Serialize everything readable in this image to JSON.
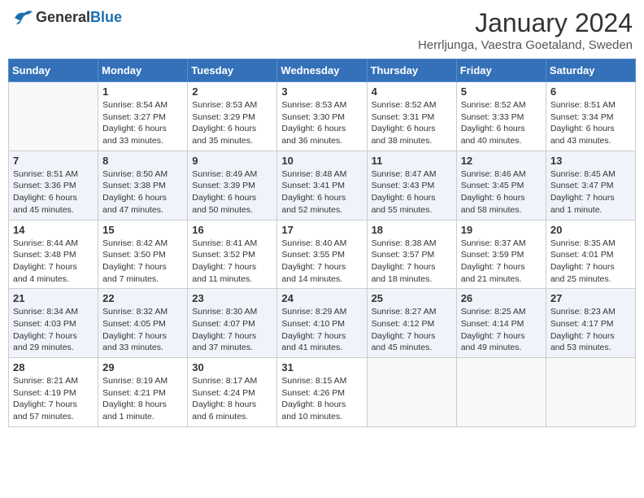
{
  "header": {
    "logo_general": "General",
    "logo_blue": "Blue",
    "title": "January 2024",
    "subtitle": "Herrljunga, Vaestra Goetaland, Sweden"
  },
  "columns": [
    "Sunday",
    "Monday",
    "Tuesday",
    "Wednesday",
    "Thursday",
    "Friday",
    "Saturday"
  ],
  "weeks": [
    [
      {
        "day": "",
        "info": ""
      },
      {
        "day": "1",
        "info": "Sunrise: 8:54 AM\nSunset: 3:27 PM\nDaylight: 6 hours\nand 33 minutes."
      },
      {
        "day": "2",
        "info": "Sunrise: 8:53 AM\nSunset: 3:29 PM\nDaylight: 6 hours\nand 35 minutes."
      },
      {
        "day": "3",
        "info": "Sunrise: 8:53 AM\nSunset: 3:30 PM\nDaylight: 6 hours\nand 36 minutes."
      },
      {
        "day": "4",
        "info": "Sunrise: 8:52 AM\nSunset: 3:31 PM\nDaylight: 6 hours\nand 38 minutes."
      },
      {
        "day": "5",
        "info": "Sunrise: 8:52 AM\nSunset: 3:33 PM\nDaylight: 6 hours\nand 40 minutes."
      },
      {
        "day": "6",
        "info": "Sunrise: 8:51 AM\nSunset: 3:34 PM\nDaylight: 6 hours\nand 43 minutes."
      }
    ],
    [
      {
        "day": "7",
        "info": "Sunrise: 8:51 AM\nSunset: 3:36 PM\nDaylight: 6 hours\nand 45 minutes."
      },
      {
        "day": "8",
        "info": "Sunrise: 8:50 AM\nSunset: 3:38 PM\nDaylight: 6 hours\nand 47 minutes."
      },
      {
        "day": "9",
        "info": "Sunrise: 8:49 AM\nSunset: 3:39 PM\nDaylight: 6 hours\nand 50 minutes."
      },
      {
        "day": "10",
        "info": "Sunrise: 8:48 AM\nSunset: 3:41 PM\nDaylight: 6 hours\nand 52 minutes."
      },
      {
        "day": "11",
        "info": "Sunrise: 8:47 AM\nSunset: 3:43 PM\nDaylight: 6 hours\nand 55 minutes."
      },
      {
        "day": "12",
        "info": "Sunrise: 8:46 AM\nSunset: 3:45 PM\nDaylight: 6 hours\nand 58 minutes."
      },
      {
        "day": "13",
        "info": "Sunrise: 8:45 AM\nSunset: 3:47 PM\nDaylight: 7 hours\nand 1 minute."
      }
    ],
    [
      {
        "day": "14",
        "info": "Sunrise: 8:44 AM\nSunset: 3:48 PM\nDaylight: 7 hours\nand 4 minutes."
      },
      {
        "day": "15",
        "info": "Sunrise: 8:42 AM\nSunset: 3:50 PM\nDaylight: 7 hours\nand 7 minutes."
      },
      {
        "day": "16",
        "info": "Sunrise: 8:41 AM\nSunset: 3:52 PM\nDaylight: 7 hours\nand 11 minutes."
      },
      {
        "day": "17",
        "info": "Sunrise: 8:40 AM\nSunset: 3:55 PM\nDaylight: 7 hours\nand 14 minutes."
      },
      {
        "day": "18",
        "info": "Sunrise: 8:38 AM\nSunset: 3:57 PM\nDaylight: 7 hours\nand 18 minutes."
      },
      {
        "day": "19",
        "info": "Sunrise: 8:37 AM\nSunset: 3:59 PM\nDaylight: 7 hours\nand 21 minutes."
      },
      {
        "day": "20",
        "info": "Sunrise: 8:35 AM\nSunset: 4:01 PM\nDaylight: 7 hours\nand 25 minutes."
      }
    ],
    [
      {
        "day": "21",
        "info": "Sunrise: 8:34 AM\nSunset: 4:03 PM\nDaylight: 7 hours\nand 29 minutes."
      },
      {
        "day": "22",
        "info": "Sunrise: 8:32 AM\nSunset: 4:05 PM\nDaylight: 7 hours\nand 33 minutes."
      },
      {
        "day": "23",
        "info": "Sunrise: 8:30 AM\nSunset: 4:07 PM\nDaylight: 7 hours\nand 37 minutes."
      },
      {
        "day": "24",
        "info": "Sunrise: 8:29 AM\nSunset: 4:10 PM\nDaylight: 7 hours\nand 41 minutes."
      },
      {
        "day": "25",
        "info": "Sunrise: 8:27 AM\nSunset: 4:12 PM\nDaylight: 7 hours\nand 45 minutes."
      },
      {
        "day": "26",
        "info": "Sunrise: 8:25 AM\nSunset: 4:14 PM\nDaylight: 7 hours\nand 49 minutes."
      },
      {
        "day": "27",
        "info": "Sunrise: 8:23 AM\nSunset: 4:17 PM\nDaylight: 7 hours\nand 53 minutes."
      }
    ],
    [
      {
        "day": "28",
        "info": "Sunrise: 8:21 AM\nSunset: 4:19 PM\nDaylight: 7 hours\nand 57 minutes."
      },
      {
        "day": "29",
        "info": "Sunrise: 8:19 AM\nSunset: 4:21 PM\nDaylight: 8 hours\nand 1 minute."
      },
      {
        "day": "30",
        "info": "Sunrise: 8:17 AM\nSunset: 4:24 PM\nDaylight: 8 hours\nand 6 minutes."
      },
      {
        "day": "31",
        "info": "Sunrise: 8:15 AM\nSunset: 4:26 PM\nDaylight: 8 hours\nand 10 minutes."
      },
      {
        "day": "",
        "info": ""
      },
      {
        "day": "",
        "info": ""
      },
      {
        "day": "",
        "info": ""
      }
    ]
  ]
}
